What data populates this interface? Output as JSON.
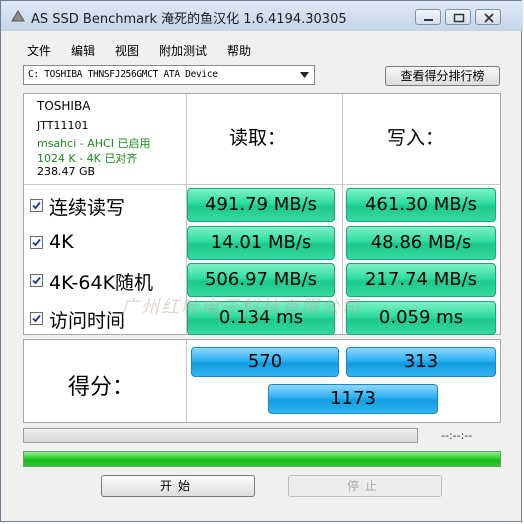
{
  "window": {
    "title": "AS SSD Benchmark 淹死的鱼汉化 1.6.4194.30305"
  },
  "menu": [
    "文件",
    "编辑",
    "视图",
    "附加测试",
    "帮助"
  ],
  "drive_select": {
    "value": "C: TOSHIBA THNSFJ256GMCT ATA Device"
  },
  "rank_button": "查看得分排行榜",
  "drive_info": {
    "vendor": "TOSHIBA",
    "firmware": "JTT11101",
    "driver": "msahci - AHCI 已启用",
    "alignment": "1024 K - 4K 已对齐",
    "capacity": "238.47 GB"
  },
  "columns": {
    "read": "读取：",
    "write": "写入："
  },
  "rows": [
    {
      "label": "连续读写",
      "checked": true,
      "read": "491.79 MB/s",
      "write": "461.30 MB/s"
    },
    {
      "label": "4K",
      "checked": true,
      "read": "14.01 MB/s",
      "write": "48.86 MB/s"
    },
    {
      "label": "4K-64K随机",
      "checked": true,
      "read": "506.97 MB/s",
      "write": "217.74 MB/s"
    },
    {
      "label": "访问时间",
      "checked": true,
      "read": "0.134 ms",
      "write": "0.059 ms"
    }
  ],
  "score": {
    "label": "得分：",
    "read": "570",
    "write": "313",
    "total": "1173"
  },
  "progress": {
    "time": "--:--:--",
    "top_fraction": 0,
    "bottom_fraction": 1
  },
  "buttons": {
    "start": "开始",
    "stop": "停止"
  },
  "watermark": "广州红叶电子科技有限公司",
  "colors": {
    "result_cell": "#2fdca0",
    "score_cell": "#2cb0f2",
    "progress_fill": "#22c522"
  }
}
